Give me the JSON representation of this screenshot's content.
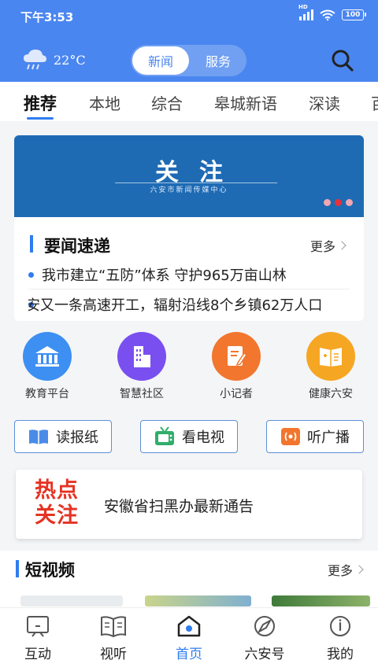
{
  "status_bar": {
    "time": "下午3:53",
    "battery": "100",
    "signal_badge": "HD"
  },
  "header": {
    "temperature": "22°C",
    "weather_icon": "cloud-rain-icon",
    "segment": {
      "active": "新闻",
      "inactive": "服务"
    },
    "search_icon": "search-icon"
  },
  "tabs": [
    "推荐",
    "本地",
    "综合",
    "皋城新语",
    "深读",
    "百"
  ],
  "banner": {
    "title": "关注",
    "subtitle": "六安市新闻传媒中心"
  },
  "news_flash": {
    "title": "要闻速递",
    "more_label": "更多",
    "items": [
      "我市建立“五防”体系 守护965万亩山林",
      "安又一条高速开工，辐射沿线8个乡镇62万人口"
    ]
  },
  "services": [
    {
      "label": "教育平台",
      "icon": "school-icon",
      "color": "#3d8ff2"
    },
    {
      "label": "智慧社区",
      "icon": "building-icon",
      "color": "#7a4ff0"
    },
    {
      "label": "小记者",
      "icon": "edit-note-icon",
      "color": "#f2762e"
    },
    {
      "label": "健康六安",
      "icon": "health-book-icon",
      "color": "#f5a623"
    }
  ],
  "media": [
    {
      "label": "读报纸",
      "icon": "newspaper-icon"
    },
    {
      "label": "看电视",
      "icon": "tv-icon"
    },
    {
      "label": "听广播",
      "icon": "radio-icon"
    }
  ],
  "hot": {
    "mark_line1": "热点",
    "mark_line2": "关注",
    "text": "安徽省扫黑办最新通告"
  },
  "short_video": {
    "title": "短视频",
    "more_label": "更多"
  },
  "bottom_nav": [
    {
      "label": "互动",
      "icon": "chat-screen-icon"
    },
    {
      "label": "视听",
      "icon": "open-book-icon"
    },
    {
      "label": "首页",
      "icon": "home-icon",
      "active": true
    },
    {
      "label": "六安号",
      "icon": "compass-icon"
    },
    {
      "label": "我的",
      "icon": "user-icon"
    }
  ],
  "colors": {
    "primary": "#4a86f0",
    "accent": "#2f7cf0",
    "hot_red": "#e63222",
    "banner_blue": "#1e6bb4"
  }
}
